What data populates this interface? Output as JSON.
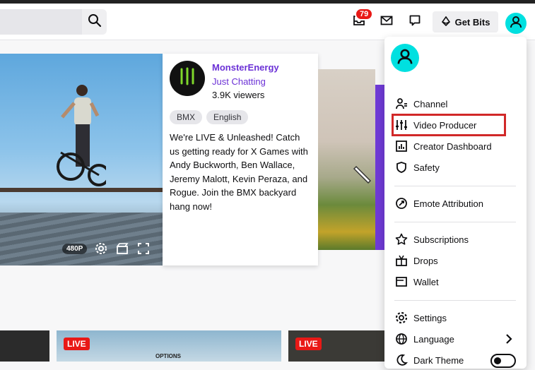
{
  "header": {
    "search_placeholder": "",
    "notifications_count": "79",
    "get_bits_label": "Get Bits"
  },
  "player": {
    "quality_label": "480P"
  },
  "channel_card": {
    "name": "MonsterEnergy",
    "category": "Just Chatting",
    "viewers": "3.9K viewers",
    "tags": [
      "BMX",
      "English"
    ],
    "description": "We're LIVE & Unleashed! Catch us getting ready for X Games with Andy Buckworth, Ben Wallace, Jeremy Malott, Kevin Peraza, and Rogue. Join the BMX backyard hang now!"
  },
  "thumbnails": {
    "live_label": "LIVE",
    "options_label": "OPTIONS"
  },
  "user_menu": {
    "items": [
      {
        "label": "Channel",
        "icon": "channel-icon"
      },
      {
        "label": "Video Producer",
        "icon": "sliders-icon"
      },
      {
        "label": "Creator Dashboard",
        "icon": "dashboard-icon"
      },
      {
        "label": "Safety",
        "icon": "shield-icon"
      },
      {
        "label": "Emote Attribution",
        "icon": "attribution-icon"
      },
      {
        "label": "Subscriptions",
        "icon": "star-icon"
      },
      {
        "label": "Drops",
        "icon": "gift-icon"
      },
      {
        "label": "Wallet",
        "icon": "wallet-icon"
      },
      {
        "label": "Settings",
        "icon": "gear-icon"
      },
      {
        "label": "Language",
        "icon": "globe-icon"
      },
      {
        "label": "Dark Theme",
        "icon": "moon-icon"
      }
    ],
    "highlighted_item": "Video Producer",
    "dark_theme_on": false
  },
  "colors": {
    "accent": "#6b31d6",
    "live_red": "#e91916",
    "highlight_border": "#d12828",
    "avatar": "#00e0e0"
  }
}
